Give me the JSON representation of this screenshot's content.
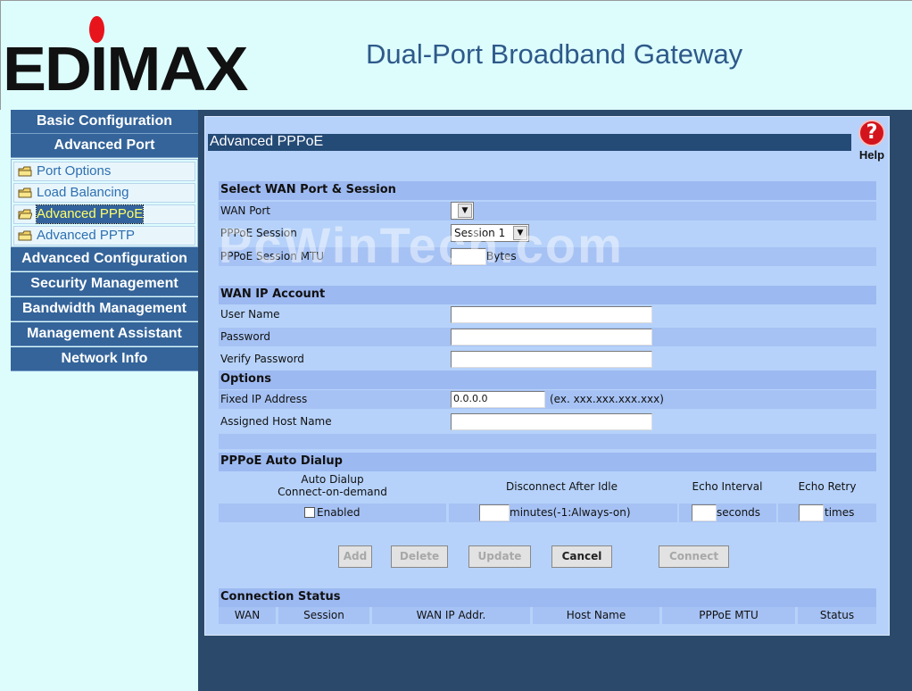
{
  "header": {
    "logo_text": "EDIMAX",
    "title": "Dual-Port Broadband Gateway"
  },
  "sidebar": {
    "items": [
      {
        "label": "Basic Configuration"
      },
      {
        "label": "Advanced Port"
      },
      {
        "label": "Advanced Configuration"
      },
      {
        "label": "Security Management"
      },
      {
        "label": "Bandwidth Management"
      },
      {
        "label": "Management Assistant"
      },
      {
        "label": "Network Info"
      }
    ],
    "subitems": [
      {
        "label": "Port Options",
        "active": false
      },
      {
        "label": "Load Balancing",
        "active": false
      },
      {
        "label": "Advanced PPPoE",
        "active": true
      },
      {
        "label": "Advanced PPTP",
        "active": false
      }
    ]
  },
  "page": {
    "title": "Advanced PPPoE",
    "help_label": "Help",
    "help_icon": "question-mark-icon"
  },
  "wan_section": {
    "header": "Select WAN Port & Session",
    "wan_port_label": "WAN Port",
    "wan_port_value": "",
    "session_label": "PPPoE Session",
    "session_value": "Session 1",
    "mtu_label": "PPPoE Session MTU",
    "mtu_value": "",
    "mtu_unit": "Bytes"
  },
  "account_section": {
    "header": "WAN IP Account",
    "user_label": "User Name",
    "user_value": "",
    "password_label": "Password",
    "password_value": "",
    "verify_label": "Verify Password",
    "verify_value": ""
  },
  "options_section": {
    "header": "Options",
    "fixed_ip_label": "Fixed IP Address",
    "fixed_ip_value": "0.0.0.0",
    "fixed_ip_hint": "(ex. xxx.xxx.xxx.xxx)",
    "host_label": "Assigned Host Name",
    "host_value": ""
  },
  "autodial_section": {
    "header": "PPPoE Auto Dialup",
    "col_auto_line1": "Auto Dialup",
    "col_auto_line2": "Connect-on-demand",
    "col_disconnect": "Disconnect After Idle",
    "col_echo_interval": "Echo Interval",
    "col_echo_retry": "Echo Retry",
    "enabled_label": "Enabled",
    "enabled_checked": false,
    "idle_value": "",
    "idle_unit": "minutes(-1:Always-on)",
    "interval_value": "",
    "interval_unit": "seconds",
    "retry_value": "",
    "retry_unit": "times"
  },
  "buttons": {
    "add": "Add",
    "delete": "Delete",
    "update": "Update",
    "cancel": "Cancel",
    "connect": "Connect"
  },
  "status_section": {
    "header": "Connection Status",
    "columns": [
      "WAN",
      "Session",
      "WAN IP Addr.",
      "Host Name",
      "PPPoE MTU",
      "Status"
    ]
  },
  "watermark": "PcWinTech.com"
}
